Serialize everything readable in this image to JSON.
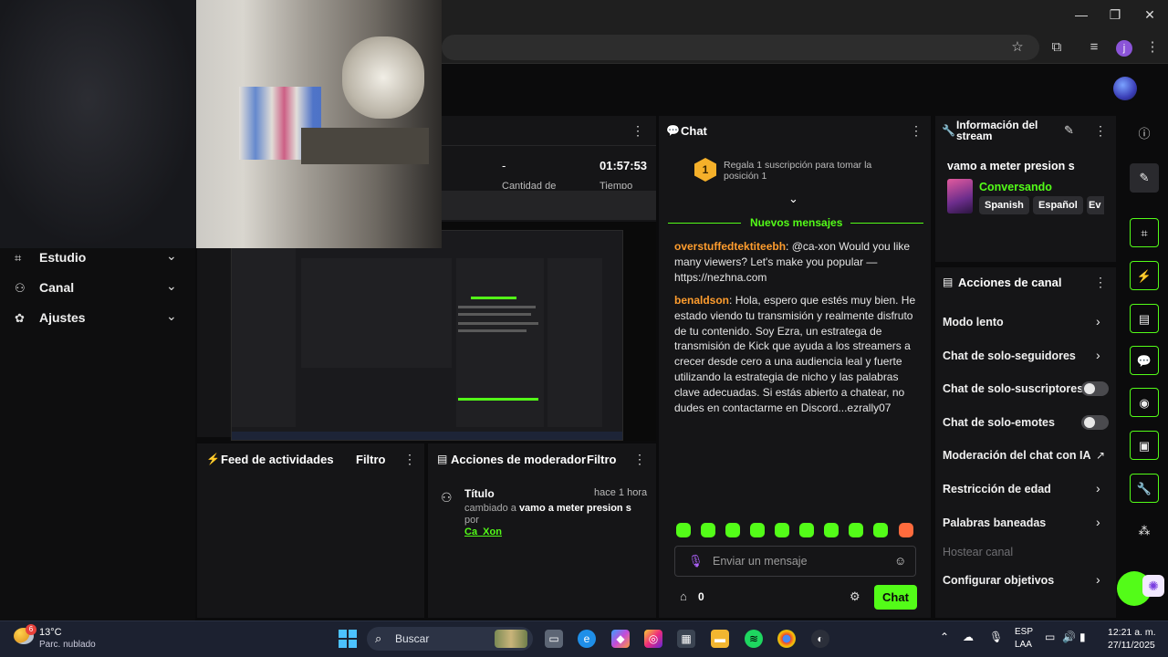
{
  "window": {
    "controls": [
      "—",
      "❐",
      "✕"
    ],
    "profile_initial": "j"
  },
  "sidebar": {
    "items": [
      {
        "label": "Estudio",
        "icon": "studio-icon"
      },
      {
        "label": "Canal",
        "icon": "channel-icon"
      },
      {
        "label": "Ajustes",
        "icon": "settings-icon"
      }
    ]
  },
  "stream": {
    "stat_dash": "-",
    "stat_time": "01:57:53",
    "stat_label_a": "Cantidad de",
    "stat_label_b": "Tiempo"
  },
  "feed": {
    "title": "Feed de actividades",
    "filter": "Filtro"
  },
  "mod": {
    "title": "Acciones de moderador",
    "filter": "Filtro",
    "entry": {
      "title": "Título",
      "time": "hace 1 hora",
      "text_prefix": "cambiado a ",
      "new_title": "vamo a meter presion s",
      "by": " por ",
      "user": "Ca_Xon"
    }
  },
  "chat": {
    "title": "Chat",
    "rank_number": "1",
    "promo": "Regala 1 suscripción para tomar la posición 1",
    "new_messages": "Nuevos mensajes",
    "messages": [
      {
        "user": "overstuffedtektiteebh",
        "text": "@ca-xon Would you like many viewers? Let's make you popular — https://nezhna.com"
      },
      {
        "user": "benaldson",
        "text": "Hola, espero que estés muy bien. He estado viendo tu transmisión y realmente disfruto de tu contenido. Soy Ezra, un estratega de transmisión de Kick que ayuda a los streamers a crecer desde cero a una audiencia leal y fuerte utilizando la estrategia de nicho y las palabras clave adecuadas. Si estás abierto a chatear, no dudes en contactarme en Discord...ezrally07"
      }
    ],
    "input_placeholder": "Enviar un mensaje",
    "points": "0",
    "send_label": "Chat"
  },
  "info": {
    "title": "Información del stream",
    "stream_title": "vamo a meter presion s",
    "category": "Conversando",
    "tags": [
      "Spanish",
      "Español",
      "Ev"
    ]
  },
  "actions": {
    "title": "Acciones de canal",
    "items": [
      {
        "label": "Modo lento",
        "kind": "chevron"
      },
      {
        "label": "Chat de solo-seguidores",
        "kind": "chevron"
      },
      {
        "label": "Chat de solo-suscriptores",
        "kind": "toggle",
        "on": false
      },
      {
        "label": "Chat de solo-emotes",
        "kind": "toggle",
        "on": false
      },
      {
        "label": "Moderación del chat con IA",
        "kind": "external"
      },
      {
        "label": "Restricción de edad",
        "kind": "chevron"
      },
      {
        "label": "Palabras baneadas",
        "kind": "chevron"
      },
      {
        "label": "Hostear canal",
        "kind": "disabled"
      },
      {
        "label": "Configurar objetivos",
        "kind": "chevron"
      }
    ]
  },
  "taskbar": {
    "temp": "13°C",
    "weather": "Parc. nublado",
    "weather_badge": "6",
    "search": "Buscar",
    "lang": "ESP",
    "layout": "LAA",
    "time": "12:21 a. m.",
    "date": "27/11/2025"
  },
  "colors": {
    "accent": "#53fc18",
    "panel": "#151517",
    "background": "#0b0b0c",
    "username": "#ff9d2e"
  }
}
